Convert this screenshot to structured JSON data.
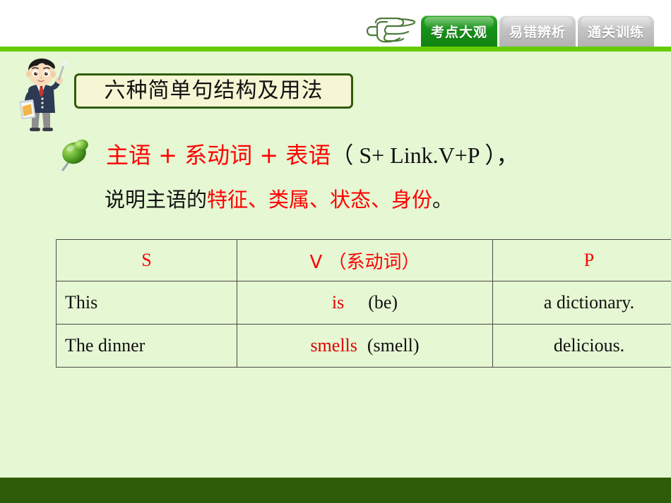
{
  "meta": {
    "accent_green": "#66cc00",
    "footer_green": "#2f5c09",
    "body_bg": "#e5f7d3",
    "title_box_bg": "#f6f6d4",
    "red": "#ff0000"
  },
  "header": {
    "hand_icon": "pointing-hand-icon",
    "tabs": [
      {
        "label": "考点大观",
        "active": true
      },
      {
        "label": "易错辨析",
        "active": false
      },
      {
        "label": "通关训练",
        "active": false
      }
    ]
  },
  "title": {
    "text": "六种简单句结构及用法",
    "teacher_icon": "teacher-with-pointer-illustration"
  },
  "formula": {
    "pushpin_icon": "green-pushpin-icon",
    "chinese": "主语 + 系动词 + 表语",
    "english": "（  S+ Link.V+P ），",
    "description_prefix": "说明主语的",
    "description_red": "特征、类属、状态、身份",
    "description_suffix": "。"
  },
  "table": {
    "headers": [
      "S",
      "V （系动词）",
      "P"
    ],
    "rows": [
      {
        "s": "This",
        "v_red": "is",
        "v_black": "(be)",
        "p": "a dictionary."
      },
      {
        "s": "The dinner",
        "v_red": "smells",
        "v_black": "(smell)",
        "p": "delicious."
      }
    ]
  }
}
